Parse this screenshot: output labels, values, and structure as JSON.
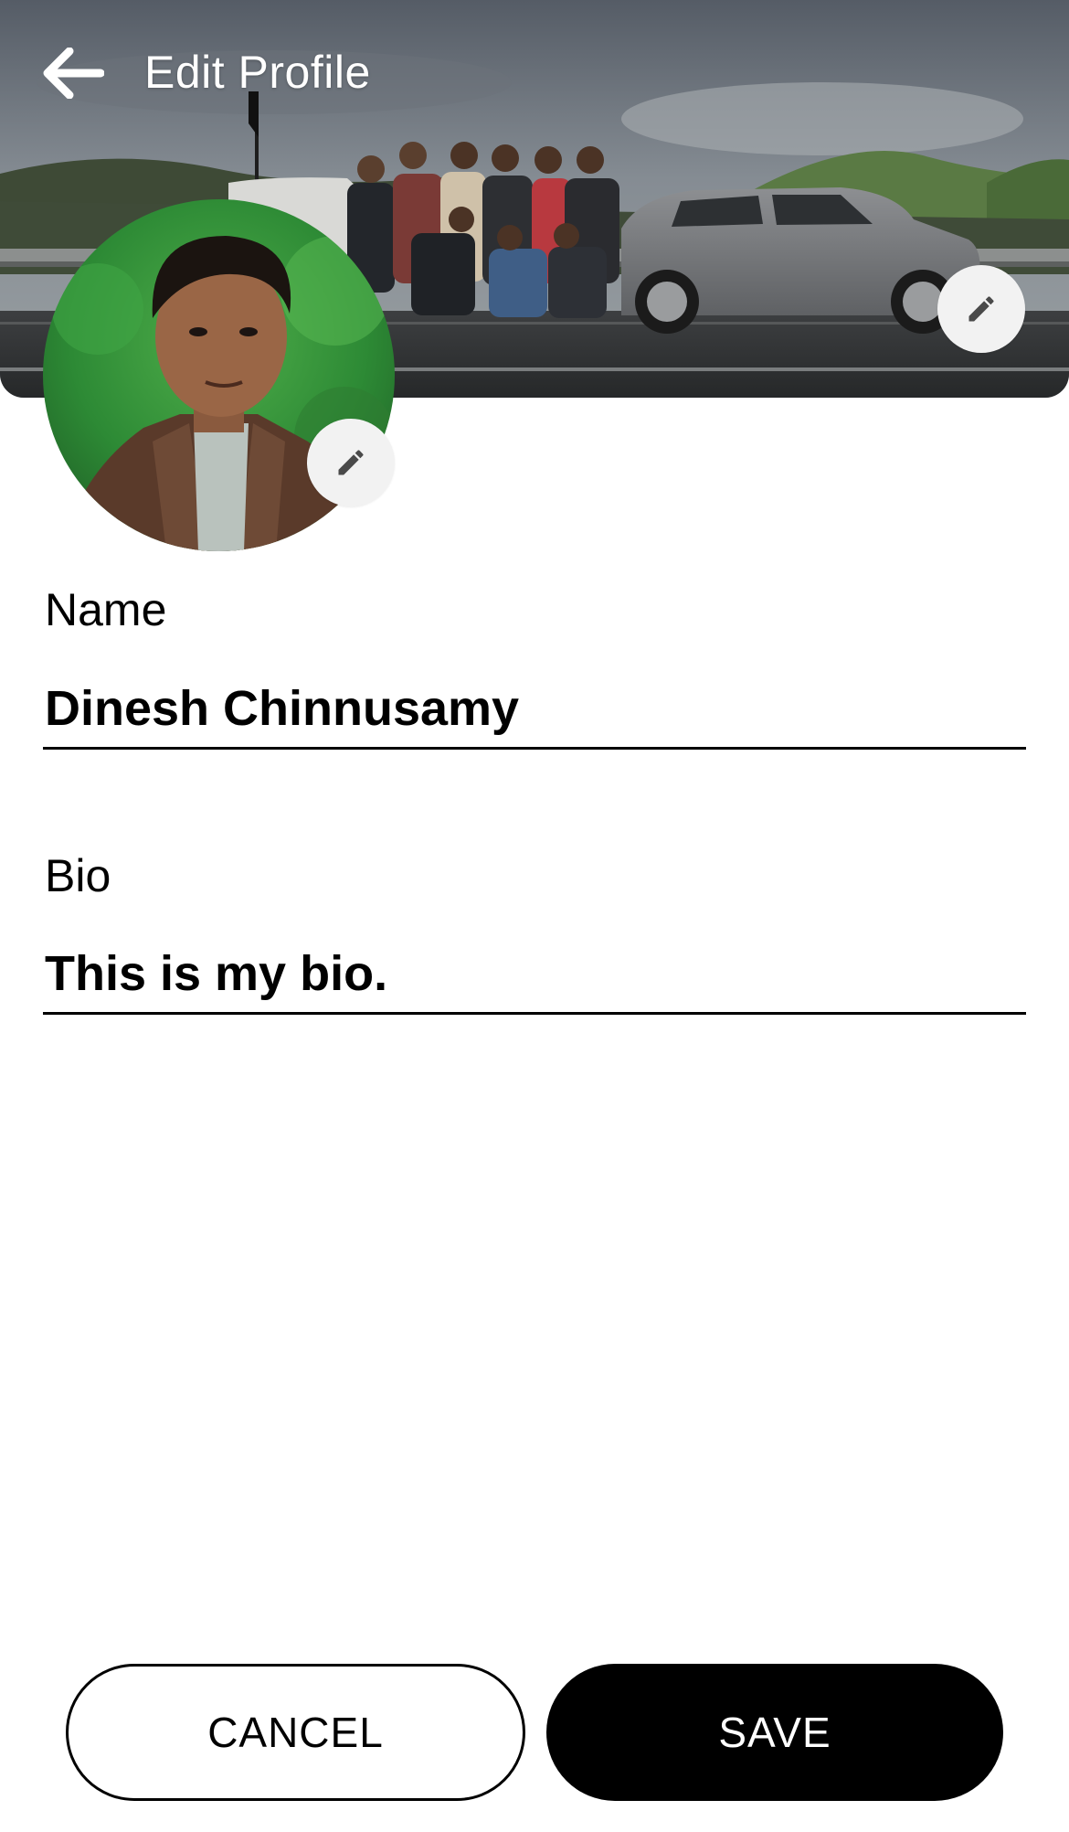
{
  "header": {
    "title": "Edit Profile",
    "back_icon": "arrow-left-icon"
  },
  "cover": {
    "edit_icon": "pencil-icon"
  },
  "avatar": {
    "edit_icon": "pencil-icon"
  },
  "form": {
    "name_label": "Name",
    "name_value": "Dinesh Chinnusamy",
    "bio_label": "Bio",
    "bio_value": "This is my bio."
  },
  "actions": {
    "cancel_label": "CANCEL",
    "save_label": "SAVE"
  }
}
